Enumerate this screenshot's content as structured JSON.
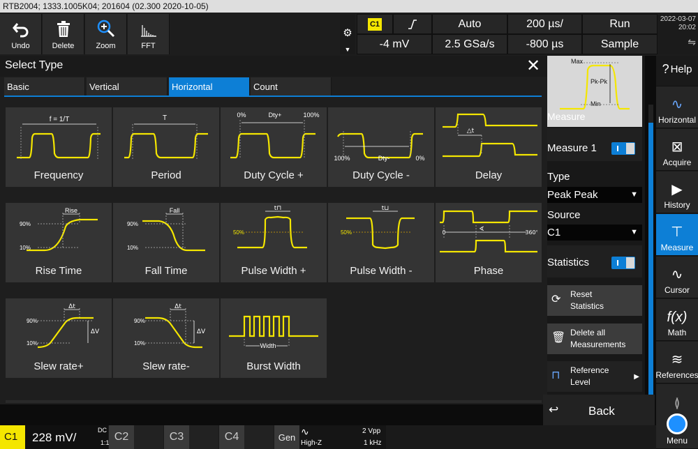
{
  "title": "RTB2004; 1333.1005K04; 201604 (02.300 2020-10-05)",
  "toolbar": {
    "buttons": [
      "Undo",
      "Delete",
      "Zoom",
      "FFT"
    ]
  },
  "status": {
    "channel": "C1",
    "trigger_level": "-4 mV",
    "trigger_mode": "Auto",
    "sample_rate": "2.5 GSa/s",
    "time_scale": "200 µs/",
    "time_offset": "-800 µs",
    "run_state": "Run",
    "acq_mode": "Sample",
    "date": "2022-03-07",
    "time": "20:02",
    "usb_icon": "usb-icon"
  },
  "dialog": {
    "title": "Select Type",
    "tabs": [
      "Basic",
      "Vertical",
      "Horizontal",
      "Count"
    ],
    "active_tab": "Horizontal",
    "tiles": [
      {
        "label": "Frequency",
        "icon_text": [
          "f = 1/T"
        ]
      },
      {
        "label": "Period",
        "icon_text": [
          "T"
        ]
      },
      {
        "label": "Duty Cycle +",
        "icon_text": [
          "0%",
          "Dty+",
          "100%"
        ]
      },
      {
        "label": "Duty Cycle -",
        "icon_text": [
          "100%",
          "Dty-",
          "0%"
        ]
      },
      {
        "label": "Delay",
        "icon_text": [
          "△t"
        ]
      },
      {
        "label": "Rise Time",
        "icon_text": [
          "Rise",
          "90%",
          "10%"
        ]
      },
      {
        "label": "Fall Time",
        "icon_text": [
          "Fall",
          "90%",
          "10%"
        ]
      },
      {
        "label": "Pulse Width +",
        "icon_text": [
          "t⊓",
          "50%"
        ]
      },
      {
        "label": "Pulse Width -",
        "icon_text": [
          "t⊔",
          "50%"
        ]
      },
      {
        "label": "Phase",
        "icon_text": [
          "0",
          "360°",
          "∢"
        ]
      },
      {
        "label": "Slew rate+",
        "icon_text": [
          "Δt",
          "90%",
          "10%",
          "ΔV"
        ]
      },
      {
        "label": "Slew rate-",
        "icon_text": [
          "Δt",
          "90%",
          "10%",
          "ΔV"
        ]
      },
      {
        "label": "Burst Width",
        "icon_text": [
          "Width"
        ]
      }
    ]
  },
  "measure_panel": {
    "thumb_labels": [
      "Max",
      "Pk-Pk",
      "Min"
    ],
    "heading": "Measure",
    "measure1_label": "Measure 1",
    "type_label": "Type",
    "type_value": "Peak Peak",
    "source_label": "Source",
    "source_value": "C1",
    "statistics_label": "Statistics",
    "reset_label": [
      "Reset",
      "Statistics"
    ],
    "delete_label": [
      "Delete all",
      "Measurements"
    ],
    "reference_label": [
      "Reference",
      "Level"
    ],
    "back_label": "Back"
  },
  "sidebar": {
    "help": "Help",
    "items": [
      "Horizontal",
      "Acquire",
      "History",
      "Measure",
      "Cursor",
      "Math",
      "References",
      "Menu"
    ]
  },
  "bottom": {
    "c1": "C1",
    "c1_scale": "228 mV/",
    "c1_coupling": "DC",
    "c1_ratio": "1:1",
    "c2": "C2",
    "c3": "C3",
    "c4": "C4",
    "gen": "Gen",
    "gen_impedance": "High-Z",
    "gen_vpp": "2 Vpp",
    "gen_freq": "1 kHz"
  },
  "colors": {
    "accent_blue": "#0d7fd6",
    "channel1_yellow": "#f4e600"
  }
}
